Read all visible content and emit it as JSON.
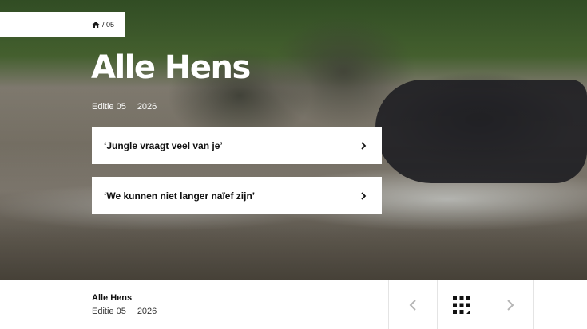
{
  "breadcrumb": {
    "icon": "home-icon",
    "text": "/ 05"
  },
  "hero": {
    "title": "Alle Hens",
    "edition": "Editie 05",
    "year": "2026"
  },
  "articles": [
    {
      "label": "‘Jungle vraagt veel van je’",
      "icon": "chevron-right-icon"
    },
    {
      "label": "‘We kunnen niet langer naïef zijn’",
      "icon": "chevron-right-icon"
    }
  ],
  "footer": {
    "title": "Alle Hens",
    "edition": "Editie 05",
    "year": "2026",
    "prev_icon": "chevron-left-icon",
    "grid_icon": "grid-icon",
    "next_icon": "chevron-right-icon"
  },
  "colors": {
    "accent": "#ffffff",
    "nav_icon": "#b5b5b5",
    "grid_icon": "#111111"
  }
}
